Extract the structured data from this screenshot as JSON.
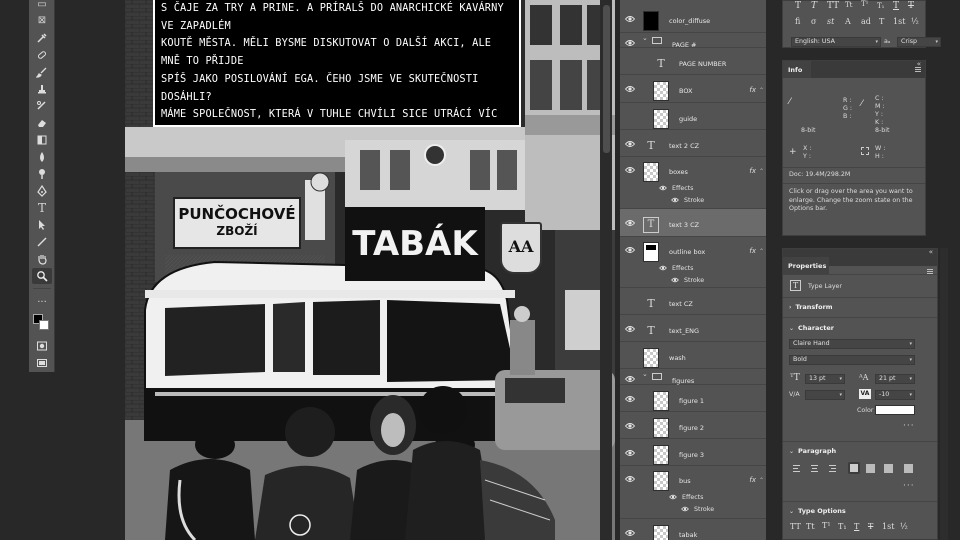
{
  "canvas": {
    "caption_text": "S ČAJE ZA TRY A PRINE. A PRÍRALŠ DO ANARCHICKÉ KAVÁRNY VE ZAPADLÉM\nKOUTĚ MĚSTA. MĚLI BYSME DISKUTOVAT O DALŠÍ AKCI, ALE MNĚ TO PŘIJDE\nSPÍŠ JAKO POSILOVÁNÍ EGA. ČEHO JSME VE SKUTEČNOSTI DOSÁHLI?\nMÁME SPOLEČNOST, KTERÁ V TUHLE CHVÍLI SICE UTRÁCÍ VÍC ZA\nBEZPEČNOST, ALE BYLA BLOKÁDA NĚČÍM VÍC NEŽ JEN MALÝM ZPOMALENÍM\nNA DÁLNICI NEVYHNUTELNÉ EKOLOGICKÉ KATASTROFY? AŤ SE SNAŽÍM, JAK\nSE SNAŽÍM, MÁM POCIT, ŽE TAHLE HRA JE PŘEDEM PROHRANÁ.",
    "sign_punc_line1": "PUNČOCHOVÉ",
    "sign_punc_line2": "ZBOŽÍ",
    "sign_tabak": "TABÁK",
    "sign_aa": "AA"
  },
  "layers": [
    {
      "name": "color_diffuse",
      "visible": true,
      "thumb": "dark"
    },
    {
      "name": "PAGE #",
      "visible": true,
      "type": "group",
      "expanded": true
    },
    {
      "name": "PAGE NUMBER",
      "visible": false,
      "type": "text",
      "indent": true
    },
    {
      "name": "BOX",
      "visible": true,
      "fx": true,
      "indent": true
    },
    {
      "name": "guide",
      "visible": false,
      "indent": true
    },
    {
      "name": "text 2 CZ",
      "visible": true,
      "type": "text"
    },
    {
      "name": "boxes",
      "visible": true,
      "fx": true
    },
    {
      "name": "text 3 CZ",
      "visible": true,
      "type": "text",
      "selected": true
    },
    {
      "name": "outline box",
      "visible": true,
      "fx": true,
      "thumb": "outline"
    },
    {
      "name": "text CZ",
      "visible": false,
      "type": "text"
    },
    {
      "name": "text_ENG",
      "visible": true,
      "type": "text"
    },
    {
      "name": "wash",
      "visible": false
    },
    {
      "name": "figures",
      "visible": true,
      "type": "group",
      "expanded": true
    },
    {
      "name": "figure 1",
      "visible": true,
      "indent": true
    },
    {
      "name": "figure 2",
      "visible": true,
      "indent": true
    },
    {
      "name": "figure 3",
      "visible": true,
      "indent": true
    },
    {
      "name": "bus",
      "visible": true,
      "fx": true,
      "indent": true
    },
    {
      "name": "tabak",
      "visible": true,
      "indent": true
    }
  ],
  "layer_effects": {
    "effects_label": "Effects",
    "stroke_label": "Stroke"
  },
  "character_top": {
    "language": "English: USA",
    "antialias_symbol": "aₐ",
    "antialias": "Crisp"
  },
  "info_panel": {
    "title": "Info",
    "r": "R :",
    "g": "G :",
    "b": "B :",
    "c": "C :",
    "m": "M :",
    "y": "Y :",
    "k": "K :",
    "bit1": "8-bit",
    "bit2": "8-bit",
    "x": "X :",
    "yv": "Y :",
    "w": "W :",
    "h": "H :",
    "doc": "Doc: 19.4M/298.2M",
    "hint": "Click or drag over the area you want to enlarge. Change the zoom state on the Options bar."
  },
  "properties": {
    "title": "Properties",
    "layer_type": "Type Layer",
    "transform_label": "Transform",
    "character_label": "Character",
    "font_family": "Claire Hand",
    "font_style": "Bold",
    "font_size": "13 pt",
    "leading": "21 pt",
    "kerning": "",
    "tracking": "-10",
    "color_label": "Color",
    "paragraph_label": "Paragraph",
    "type_options_label": "Type Options",
    "va_label": "V/A",
    "va2_label": "VA"
  },
  "colors": {
    "panel": "#535353",
    "bg": "#282828",
    "selected": "#6b6b6b",
    "tab": "#424242"
  }
}
